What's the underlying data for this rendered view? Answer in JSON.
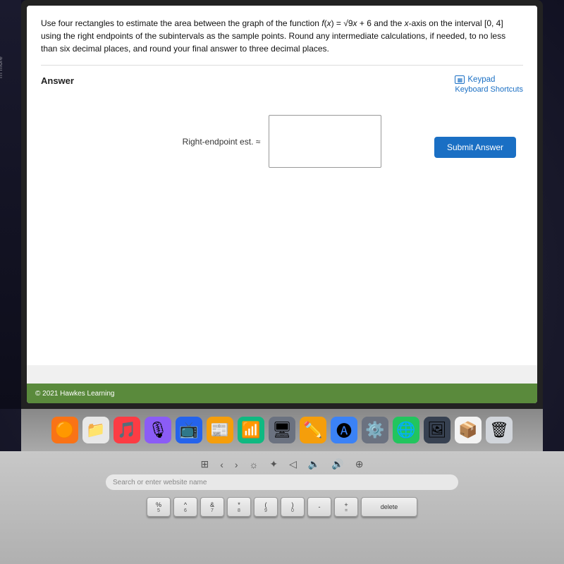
{
  "problem": {
    "text": "Use four rectangles to estimate the area between the graph of the function f(x) = √9x + 6 and the x-axis on the interval [0, 4] using the right endpoints of the subintervals as the sample points. Round any intermediate calculations, if needed, to no less than six decimal places, and round your final answer to three decimal places.",
    "function_display": "f(x) = √9x + 6",
    "interval": "[0, 4]"
  },
  "answer_section": {
    "label": "Answer",
    "keypad_label": "Keypad",
    "keyboard_shortcuts_label": "Keyboard Shortcuts",
    "input_label": "Right-endpoint est. ≈",
    "input_placeholder": ""
  },
  "footer": {
    "copyright": "© 2021 Hawkes Learning"
  },
  "submit_button": {
    "label": "Submit Answer"
  },
  "address_bar": {
    "placeholder": "Search or enter website name"
  },
  "keyboard": {
    "row1": [
      "%\n5",
      "^\n6",
      "&\n7",
      "*\n8",
      "(\n9",
      ")\n0",
      "-",
      "+\n=",
      "delete"
    ],
    "control_bar": [
      "⊞",
      "‹",
      "›",
      "⊙",
      "☼",
      "◁",
      "⊕",
      "🔊"
    ]
  },
  "dock": {
    "icons": [
      "🟠",
      "📁",
      "🎵",
      "🎙",
      "📺",
      "📰",
      "📶",
      "🖥",
      "✏️",
      "🅐",
      "⚙️",
      "🌐",
      "🖼",
      "📦",
      "🗑"
    ]
  }
}
